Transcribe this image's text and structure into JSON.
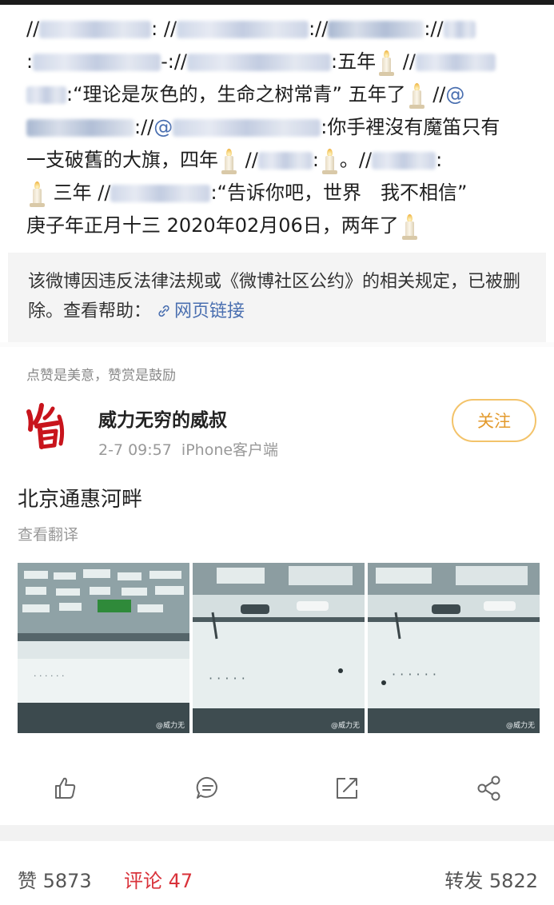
{
  "repost": {
    "l1_sep1": "//",
    "l1_sep2": ":  //",
    "l1_sep3": "://",
    "l1_sep4": "://",
    "l2_sep1": ":",
    "l2_sep2": "-://",
    "l2_text": ":五年",
    "l2_sep3": " //",
    "l3_text": ":“理论是灰色的，生命之树常青” 五年了",
    "l3_sep": " //",
    "l3_at": "@",
    "l4_sep": "://",
    "l4_at": "@",
    "l4_text": ":你手裡沒有魔笛只有",
    "l5_text1": "一支破舊的大旗，四年",
    "l5_sep": " //",
    "l5_colon": ":",
    "l5_dot": "。//",
    "l5_end": ":",
    "l6_text1": " 三年 //",
    "l6_text2": ":“告诉你吧，世界　我不相信”",
    "l7_text": "庚子年正月十三 2020年02月06日，两年了"
  },
  "notice": {
    "text": "该微博因违反法律法规或《微博社区公约》的相关规定，已被删除。查看帮助：",
    "link": "网页链接"
  },
  "encourage": "点赞是美意，赞赏是鼓励",
  "post": {
    "username": "威力无穷的威叔",
    "time": "2-7 09:57",
    "client": "iPhone客户端",
    "follow": "关注",
    "text": "北京通惠河畔",
    "translate": "查看翻译",
    "watermark": "@威力无"
  },
  "actions": {
    "like_icon": "thumbs-up-icon",
    "comment_icon": "comment-icon",
    "share_icon": "share-out-icon",
    "more_icon": "share-nodes-icon"
  },
  "stats": {
    "likes": "赞 5873",
    "comments": "评论 47",
    "reposts": "转发 5822"
  },
  "colors": {
    "link": "#4a6fb0",
    "accent_orange": "#e39a2c",
    "red": "#d9323a",
    "notice_bg": "#f4f4f4"
  }
}
